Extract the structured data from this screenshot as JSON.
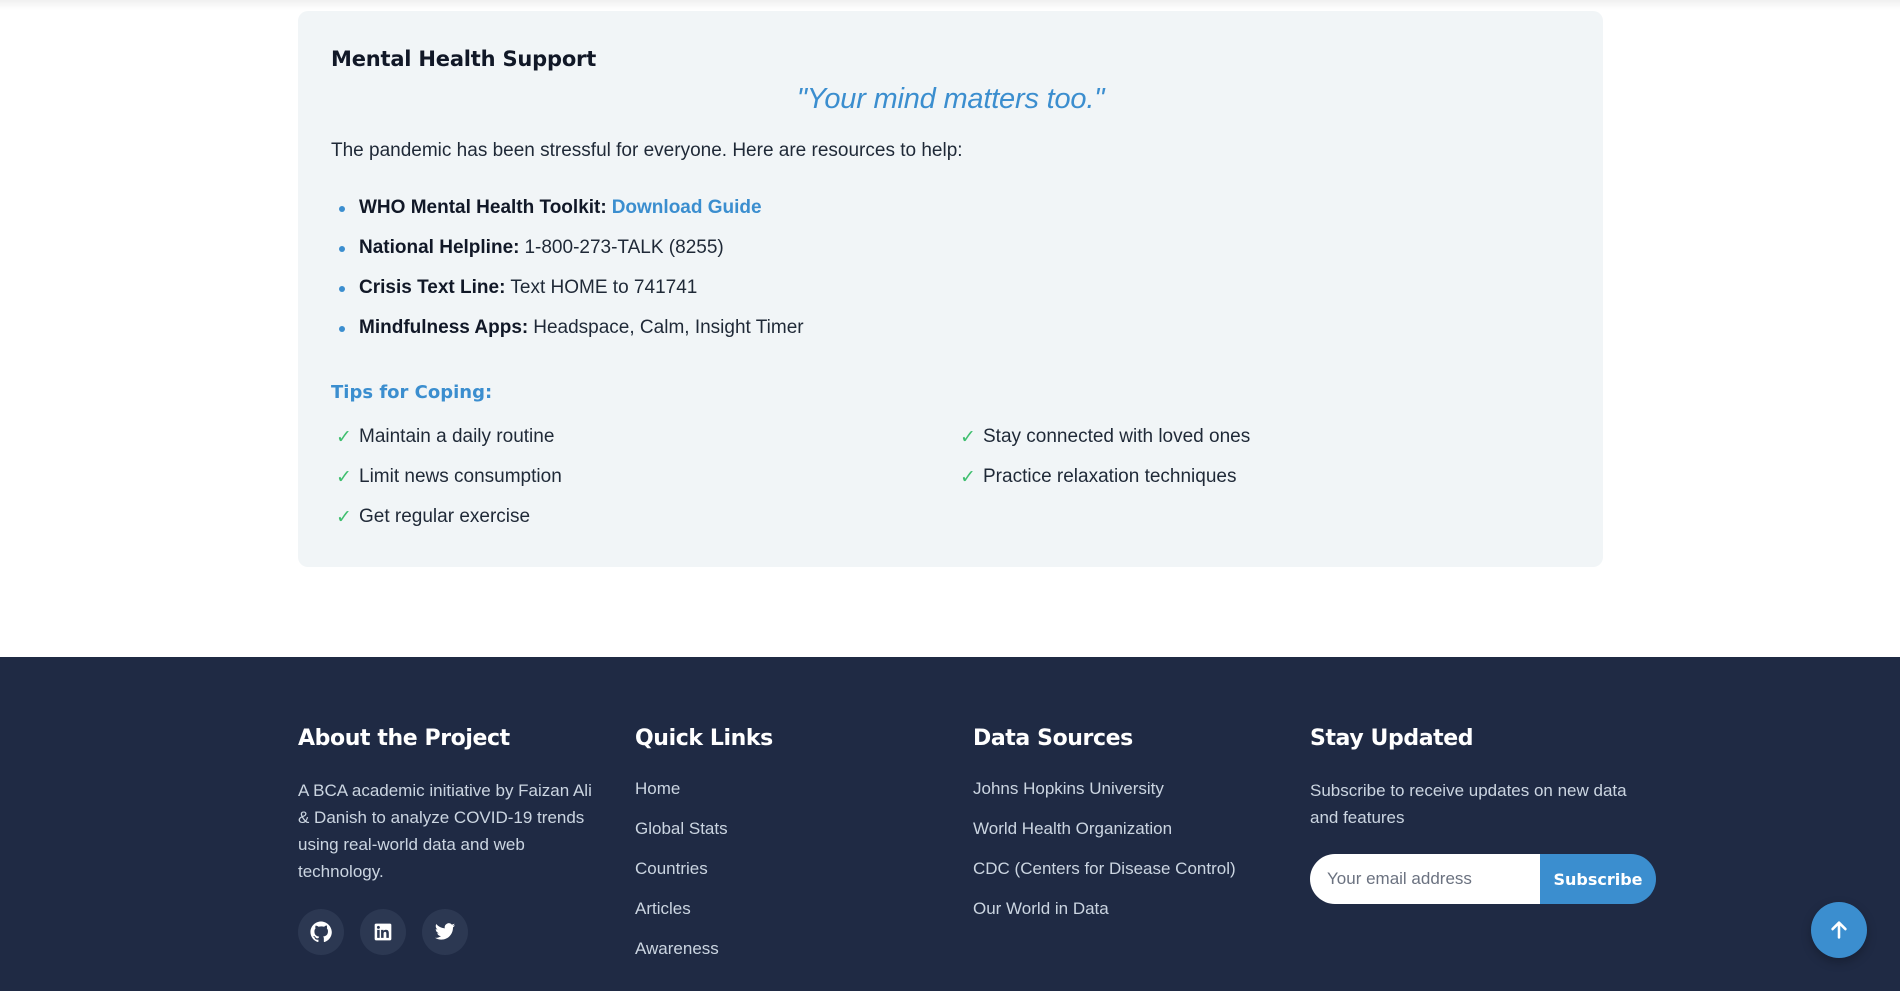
{
  "support": {
    "title": "Mental Health Support",
    "quote": "\"Your mind matters too.\"",
    "intro": "The pandemic has been stressful for everyone. Here are resources to help:",
    "resources": [
      {
        "label": "WHO Mental Health Toolkit:",
        "link": "Download Guide"
      },
      {
        "label": "National Helpline:",
        "value": "1-800-273-TALK (8255)"
      },
      {
        "label": "Crisis Text Line:",
        "value": "Text HOME to 741741"
      },
      {
        "label": "Mindfulness Apps:",
        "value": "Headspace, Calm, Insight Timer"
      }
    ],
    "tips_title": "Tips for Coping:",
    "tips": [
      "Maintain a daily routine",
      "Stay connected with loved ones",
      "Limit news consumption",
      "Practice relaxation techniques",
      "Get regular exercise"
    ],
    "check_glyph": "✓"
  },
  "footer": {
    "about": {
      "title": "About the Project",
      "text": "A BCA academic initiative by Faizan Ali & Danish to analyze COVID-19 trends using real-world data and web technology.",
      "socials": [
        "github-icon",
        "linkedin-icon",
        "twitter-icon"
      ]
    },
    "quick_links": {
      "title": "Quick Links",
      "items": [
        "Home",
        "Global Stats",
        "Countries",
        "Articles",
        "Awareness"
      ]
    },
    "data_sources": {
      "title": "Data Sources",
      "items": [
        "Johns Hopkins University",
        "World Health Organization",
        "CDC (Centers for Disease Control)",
        "Our World in Data"
      ]
    },
    "stay_updated": {
      "title": "Stay Updated",
      "text": "Subscribe to receive updates on new data and features",
      "placeholder": "Your email address",
      "button": "Subscribe"
    }
  },
  "colors": {
    "accent": "#3b8ecf",
    "check": "#3fbf6f",
    "footer_bg": "#1f2a44",
    "card_bg": "#f1f5f7"
  }
}
